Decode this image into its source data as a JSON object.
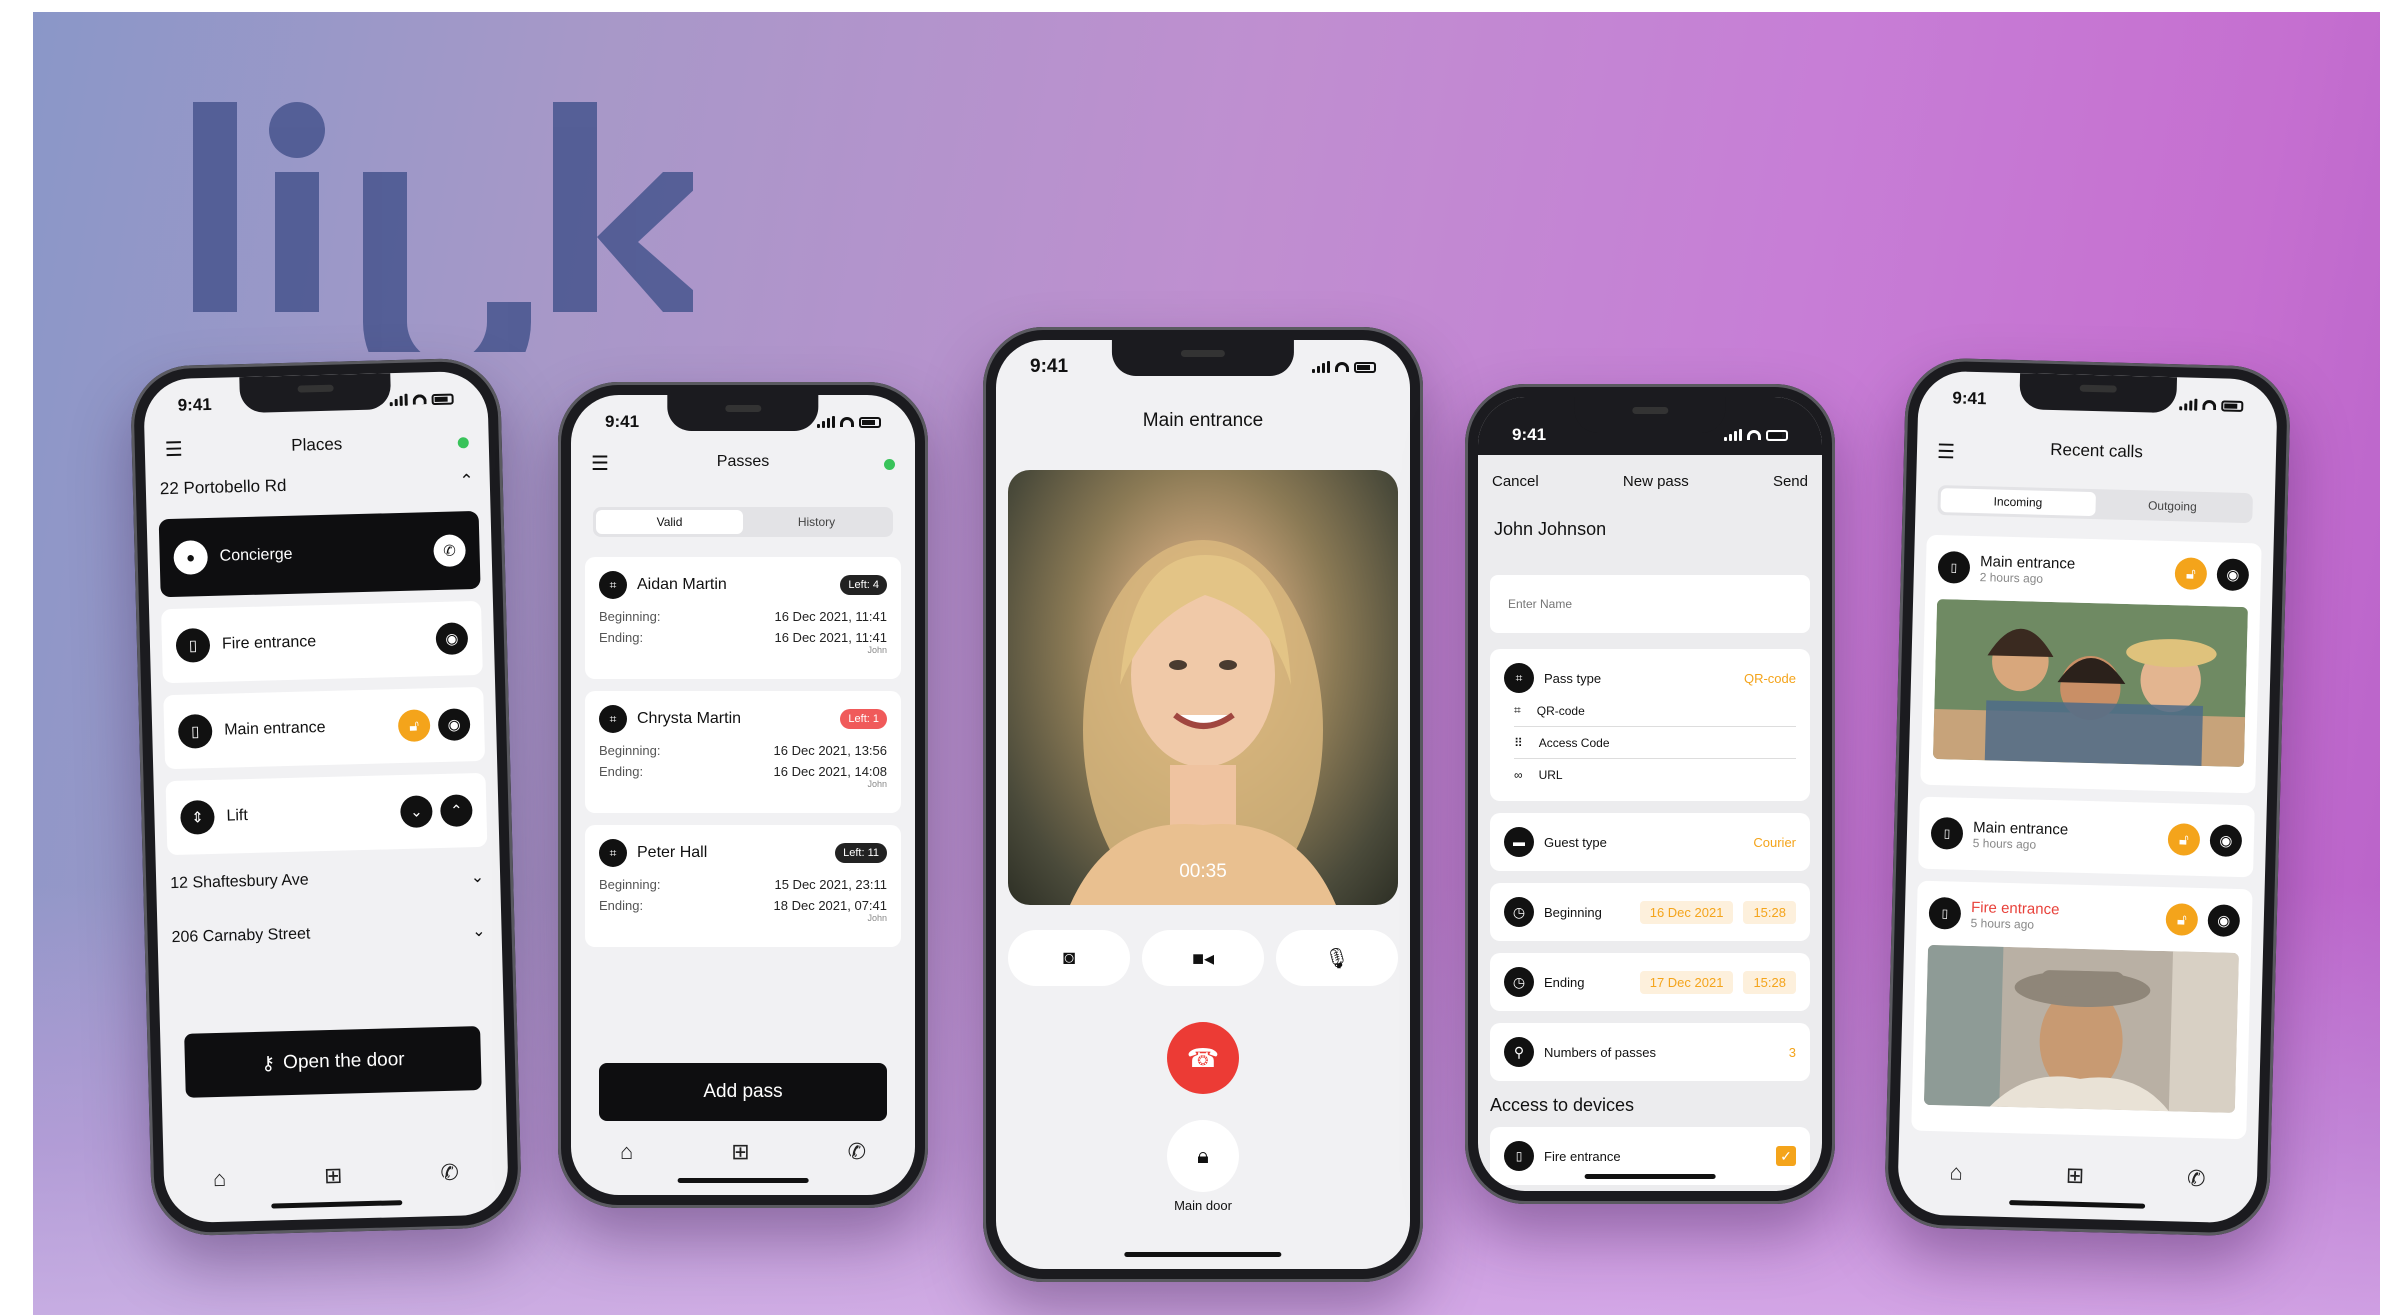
{
  "brand": {
    "logo_text": "link",
    "color": "#4e5a92"
  },
  "status_time": "9:41",
  "phone1": {
    "title": "Places",
    "status_color": "#39c35a",
    "place1": "22 Portobello Rd",
    "devices": [
      {
        "label": "Concierge"
      },
      {
        "label": "Fire entrance"
      },
      {
        "label": "Main entrance"
      },
      {
        "label": "Lift"
      }
    ],
    "place2": "12 Shaftesbury Ave",
    "place3": "206 Carnaby Street",
    "open_button": "Open the door"
  },
  "phone2": {
    "title": "Passes",
    "tabs": [
      "Valid",
      "History"
    ],
    "passes": [
      {
        "name": "Aidan Martin",
        "left": "Left: 4",
        "beginning_label": "Beginning:",
        "beginning": "16 Dec 2021, 11:41",
        "ending_label": "Ending:",
        "ending": "16 Dec 2021, 11:41",
        "by": "John"
      },
      {
        "name": "Chrysta Martin",
        "left": "Left: 1",
        "beginning_label": "Beginning:",
        "beginning": "16 Dec 2021, 13:56",
        "ending_label": "Ending:",
        "ending": "16 Dec 2021, 14:08",
        "by": "John"
      },
      {
        "name": "Peter Hall",
        "left": "Left: 11",
        "beginning_label": "Beginning:",
        "beginning": "15 Dec 2021, 23:11",
        "ending_label": "Ending:",
        "ending": "18 Dec 2021, 07:41",
        "by": "John"
      }
    ],
    "add_button": "Add pass"
  },
  "phone3": {
    "title": "Main entrance",
    "timer": "00:35",
    "door_label": "Main door",
    "hangup_color": "#ec3b35"
  },
  "phone4": {
    "cancel": "Cancel",
    "title": "New pass",
    "send": "Send",
    "name": "John Johnson",
    "name_placeholder": "Enter Name",
    "pass_type_label": "Pass type",
    "pass_type_value": "QR-code",
    "pass_options": [
      "QR-code",
      "Access Code",
      "URL"
    ],
    "guest_type_label": "Guest type",
    "guest_type_value": "Courier",
    "beginning_label": "Beginning",
    "beginning_date": "16 Dec 2021",
    "beginning_time": "15:28",
    "ending_label": "Ending",
    "ending_date": "17 Dec 2021",
    "ending_time": "15:28",
    "numbers_label": "Numbers of passes",
    "numbers_value": "3",
    "devices_header": "Access to devices",
    "device": "Fire entrance",
    "accent": "#f4a41b"
  },
  "phone5": {
    "title": "Recent calls",
    "tabs": [
      "Incoming",
      "Outgoing"
    ],
    "calls": [
      {
        "name": "Main entrance",
        "time": "2 hours ago"
      },
      {
        "name": "Main entrance",
        "time": "5 hours ago"
      },
      {
        "name": "Fire entrance",
        "time": "5 hours ago"
      }
    ],
    "alert_color": "#e8413a"
  }
}
